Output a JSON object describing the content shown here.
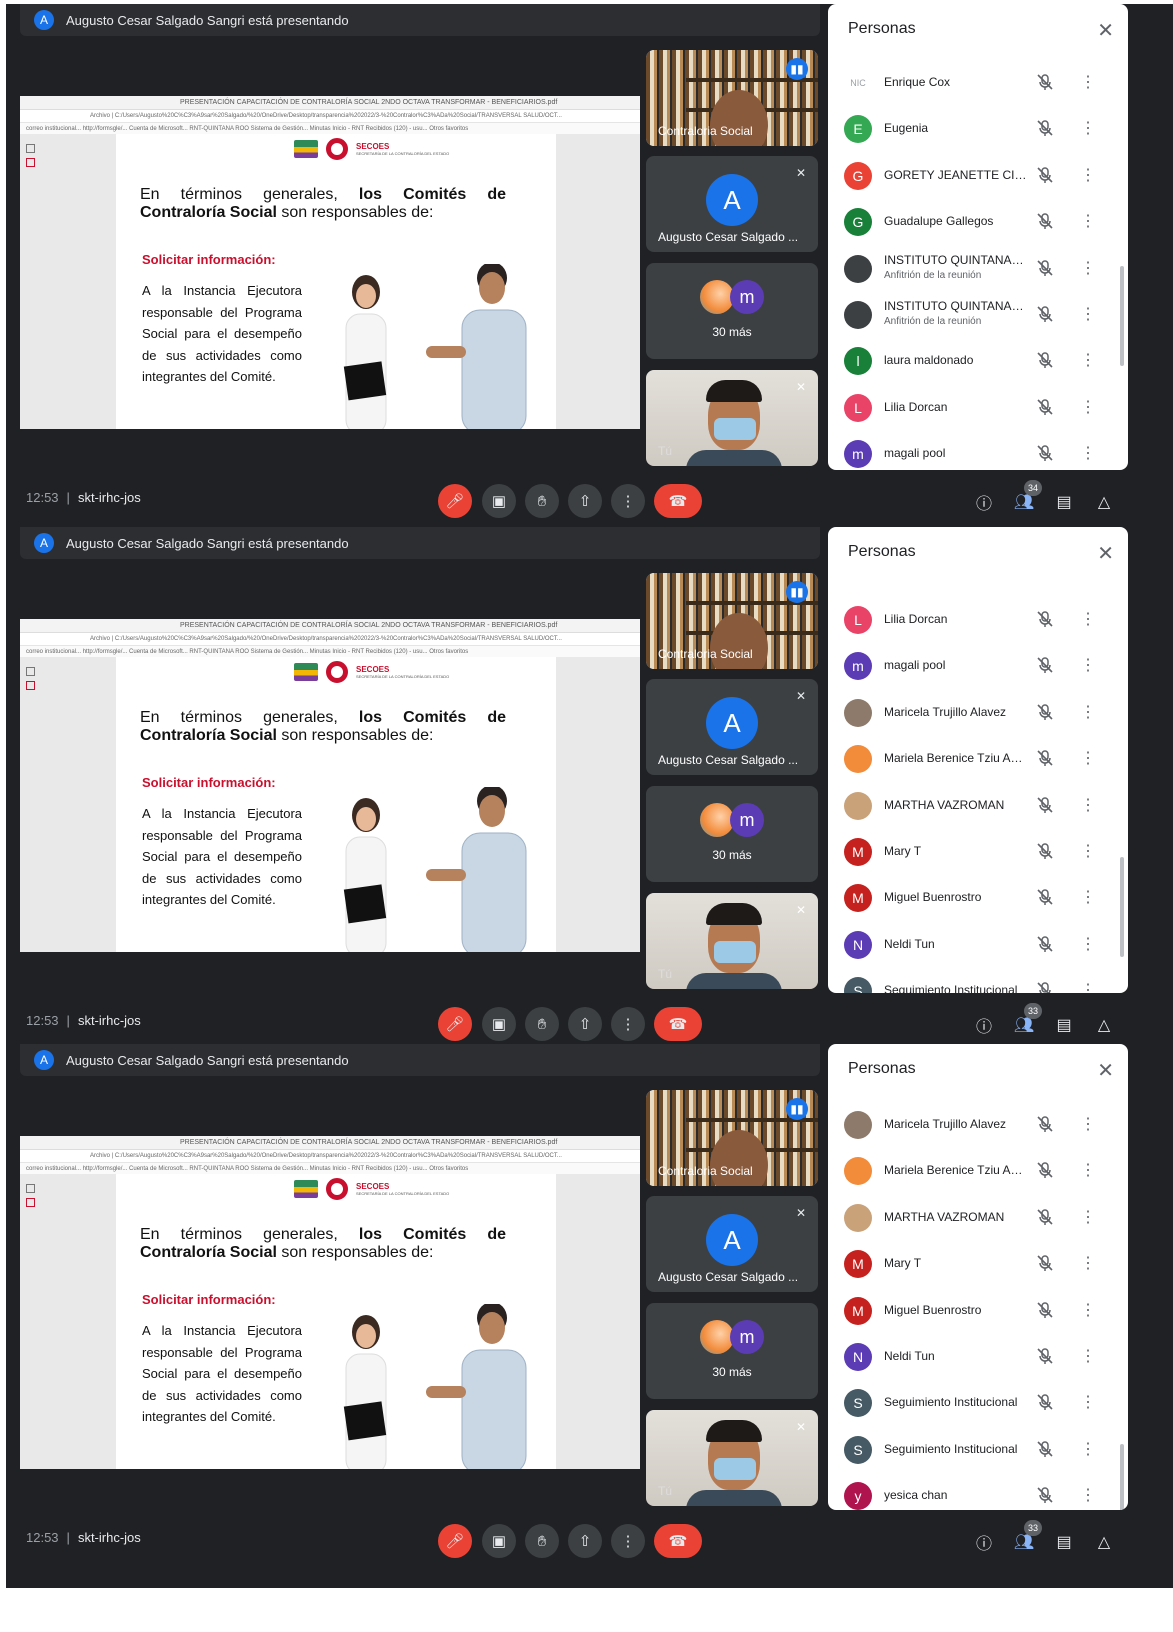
{
  "frames": [
    {
      "presenter_banner": "Augusto Cesar Salgado Sangri está presentando",
      "presenter_initial": "A",
      "participants_count": "34",
      "panel_rows": [
        {
          "name": "Enrique Cox",
          "initial": "NIC",
          "color": "#ffffff",
          "sub": ""
        },
        {
          "name": "Eugenia",
          "initial": "E",
          "color": "#34a853",
          "sub": ""
        },
        {
          "name": "GORETY JEANETTE CIME ...",
          "initial": "G",
          "color": "#ea4335",
          "sub": ""
        },
        {
          "name": "Guadalupe Gallegos",
          "initial": "G",
          "color": "#188038",
          "sub": ""
        },
        {
          "name": "INSTITUTO QUINTANARR...",
          "initial": "",
          "color": "#3c4043",
          "sub": "Anfitrión de la reunión"
        },
        {
          "name": "INSTITUTO QUINTANARR...",
          "initial": "",
          "color": "#3c4043",
          "sub": "Anfitrión de la reunión"
        },
        {
          "name": "laura maldonado",
          "initial": "l",
          "color": "#188038",
          "sub": ""
        },
        {
          "name": "Lilia Dorcan",
          "initial": "L",
          "color": "#ea4368",
          "sub": ""
        },
        {
          "name": "magali pool",
          "initial": "m",
          "color": "#5b3cb4",
          "sub": ""
        }
      ]
    },
    {
      "presenter_banner": "Augusto Cesar Salgado Sangri está presentando",
      "presenter_initial": "A",
      "participants_count": "33",
      "panel_rows": [
        {
          "name": "Lilia Dorcan",
          "initial": "L",
          "color": "#ea4368",
          "sub": ""
        },
        {
          "name": "magali pool",
          "initial": "m",
          "color": "#5b3cb4",
          "sub": ""
        },
        {
          "name": "Maricela Trujillo Alavez",
          "initial": "",
          "color": "#8e7a6a",
          "sub": ""
        },
        {
          "name": "Mariela Berenice Tziu Agui...",
          "initial": "",
          "color": "#f28b3a",
          "sub": ""
        },
        {
          "name": "MARTHA VAZROMAN",
          "initial": "",
          "color": "#c9a27a",
          "sub": ""
        },
        {
          "name": "Mary T",
          "initial": "M",
          "color": "#c5221f",
          "sub": ""
        },
        {
          "name": "Miguel Buenrostro",
          "initial": "M",
          "color": "#c5221f",
          "sub": ""
        },
        {
          "name": "Neldi Tun",
          "initial": "N",
          "color": "#5b3cb4",
          "sub": ""
        },
        {
          "name": "Seguimiento Institucional",
          "initial": "S",
          "color": "#455a64",
          "sub": ""
        }
      ]
    },
    {
      "presenter_banner": "Augusto Cesar Salgado Sangri está presentando",
      "presenter_initial": "A",
      "participants_count": "33",
      "panel_rows": [
        {
          "name": "Maricela Trujillo Alavez",
          "initial": "",
          "color": "#8e7a6a",
          "sub": ""
        },
        {
          "name": "Mariela Berenice Tziu Agui...",
          "initial": "",
          "color": "#f28b3a",
          "sub": ""
        },
        {
          "name": "MARTHA VAZROMAN",
          "initial": "",
          "color": "#c9a27a",
          "sub": ""
        },
        {
          "name": "Mary T",
          "initial": "M",
          "color": "#c5221f",
          "sub": ""
        },
        {
          "name": "Miguel Buenrostro",
          "initial": "M",
          "color": "#c5221f",
          "sub": ""
        },
        {
          "name": "Neldi Tun",
          "initial": "N",
          "color": "#5b3cb4",
          "sub": ""
        },
        {
          "name": "Seguimiento Institucional",
          "initial": "S",
          "color": "#455a64",
          "sub": ""
        },
        {
          "name": "Seguimiento Institucional",
          "initial": "S",
          "color": "#455a64",
          "sub": ""
        },
        {
          "name": "yesica chan",
          "initial": "y",
          "color": "#b0144e",
          "sub": ""
        }
      ]
    }
  ],
  "common": {
    "panel_title": "Personas",
    "time": "12:53",
    "meeting_code": "skt-irhc-jos",
    "tile_contraloria": "Contraloria Social",
    "tile_augusto_initial": "A",
    "tile_augusto": "Augusto Cesar Salgado ...",
    "tile_more_initial": "m",
    "tile_more": "30 más",
    "tile_self": "Tú",
    "icons": {
      "mic_off": "mic-off-icon",
      "camera": "camera-icon",
      "hand": "raise-hand-icon",
      "present": "present-icon",
      "more": "more-options-icon",
      "end_call": "end-call-icon",
      "info": "info-icon",
      "people": "people-icon",
      "chat": "chat-icon",
      "activities": "activities-icon"
    },
    "colors": {
      "accent": "#1a73e8",
      "danger": "#ea4335",
      "dark": "#202124",
      "slide_red": "#c8102e"
    }
  },
  "browser": {
    "tab": "PRESENTACIÓN CAPACITACIÓN DE CONTRALORÍA SOCIAL 2NDO OCTAVA TRANSFORMAR - BENEFICIARIOS.pdf",
    "address": "Archivo | C:/Users/Augusto%20C%C3%A9sar%20Salgado/%20/OneDrive/Desktop/transparencia%202022/3-%20Contralor%C3%ADa%20Social/TRANSVERSAL SALUD/OCT...",
    "bookmarks": "correo institucional...  http://formsgle/...  Cuenta de Microsoft...  RNT-QUINTANA ROO  Sistema de Gestión...  Minutas  Inicio - RNT  Recibidos (120) - usu...  Otros favoritos"
  },
  "slide": {
    "logo_org": "SECOES",
    "logo_sub": "SECRETARÍA DE LA CONTRALORÍA DEL ESTADO",
    "heading_part1": "En términos generales, ",
    "heading_bold1": "los Comités de Contraloría Social",
    "heading_part2": " son responsables de:",
    "subheading": "Solicitar información:",
    "body": "A la Instancia Ejecutora responsable del Programa Social para el desempeño de sus actividades como integrantes del Comité."
  }
}
